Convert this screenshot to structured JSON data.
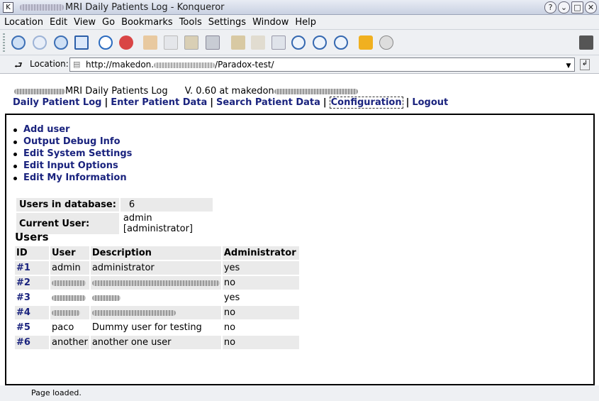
{
  "window": {
    "title": "MRI Daily Patients Log - Konqueror"
  },
  "menu": {
    "items": [
      "Location",
      "Edit",
      "View",
      "Go",
      "Bookmarks",
      "Tools",
      "Settings",
      "Window",
      "Help"
    ]
  },
  "location": {
    "label": "Location:",
    "url_start": "http://makedon.",
    "url_end": "/Paradox-test/"
  },
  "page": {
    "app_title": "MRI Daily Patients Log",
    "version_text": "V. 0.60 at makedon",
    "nav": [
      "Daily Patient Log",
      "Enter Patient Data",
      "Search Patient Data",
      "Configuration",
      "Logout"
    ],
    "nav_separator": "|"
  },
  "actions": [
    "Add user",
    "Output Debug Info",
    "Edit System Settings",
    "Edit Input Options",
    "Edit My Information"
  ],
  "info": {
    "users_label": "Users in database:",
    "users_value": "6",
    "current_label": "Current User:",
    "current_value": "admin [administrator]"
  },
  "users": {
    "heading": "Users",
    "columns": [
      "ID",
      "User",
      "Description",
      "Administrator"
    ],
    "rows": [
      {
        "id": "#1",
        "user": "admin",
        "desc": "administrator",
        "admin": "yes"
      },
      {
        "id": "#2",
        "user": "",
        "desc": "",
        "admin": "no"
      },
      {
        "id": "#3",
        "user": "",
        "desc": "",
        "admin": "yes"
      },
      {
        "id": "#4",
        "user": "",
        "desc": "",
        "admin": "no"
      },
      {
        "id": "#5",
        "user": "paco",
        "desc": "Dummy user for testing",
        "admin": "no"
      },
      {
        "id": "#6",
        "user": "another",
        "desc": "another one user",
        "admin": "no"
      }
    ]
  },
  "status": {
    "text": "Page loaded."
  },
  "colors": {
    "link": "#1a237e",
    "row_bg": "#eaeaea"
  }
}
